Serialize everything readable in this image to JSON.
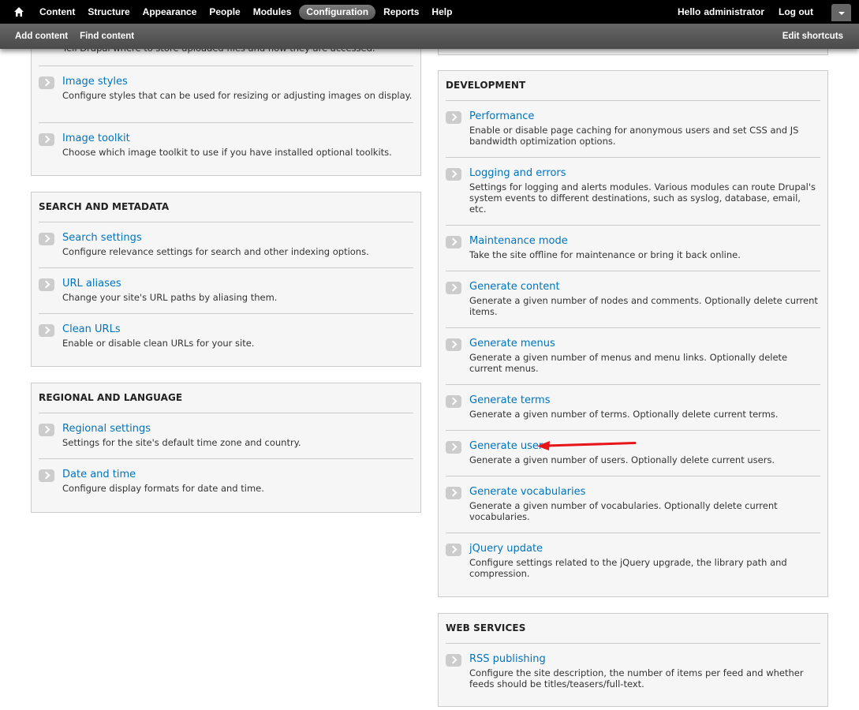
{
  "toolbar": {
    "menu": [
      "Content",
      "Structure",
      "Appearance",
      "People",
      "Modules",
      "Configuration",
      "Reports",
      "Help"
    ],
    "active_index": 5,
    "hello": "Hello",
    "username": "administrator",
    "logout": "Log out",
    "shortcuts": [
      "Add content",
      "Find content"
    ],
    "edit_shortcuts": "Edit shortcuts",
    "icons": {
      "home": "home-icon",
      "toggle": "chevron-down-icon"
    }
  },
  "left": {
    "media_tail": "Tell Drupal where to store uploaded files and how they are accessed.",
    "media_items": [
      {
        "title": "Image styles",
        "desc": "Configure styles that can be used for resizing or adjusting images on display."
      },
      {
        "title": "Image toolkit",
        "desc": "Choose which image toolkit to use if you have installed optional toolkits."
      }
    ],
    "search": {
      "heading": "SEARCH AND METADATA",
      "items": [
        {
          "title": "Search settings",
          "desc": "Configure relevance settings for search and other indexing options."
        },
        {
          "title": "URL aliases",
          "desc": "Change your site's URL paths by aliasing them."
        },
        {
          "title": "Clean URLs",
          "desc": "Enable or disable clean URLs for your site."
        }
      ]
    },
    "regional": {
      "heading": "REGIONAL AND LANGUAGE",
      "items": [
        {
          "title": "Regional settings",
          "desc": "Settings for the site's default time zone and country."
        },
        {
          "title": "Date and time",
          "desc": "Configure display formats for date and time."
        }
      ]
    }
  },
  "right": {
    "development": {
      "heading": "DEVELOPMENT",
      "items": [
        {
          "title": "Performance",
          "desc": "Enable or disable page caching for anonymous users and set CSS and JS bandwidth optimization options."
        },
        {
          "title": "Logging and errors",
          "desc": "Settings for logging and alerts modules. Various modules can route Drupal's system events to different destinations, such as syslog, database, email, etc."
        },
        {
          "title": "Maintenance mode",
          "desc": "Take the site offline for maintenance or bring it back online."
        },
        {
          "title": "Generate content",
          "desc": "Generate a given number of nodes and comments. Optionally delete current items."
        },
        {
          "title": "Generate menus",
          "desc": "Generate a given number of menus and menu links. Optionally delete current menus."
        },
        {
          "title": "Generate terms",
          "desc": "Generate a given number of terms. Optionally delete current terms."
        },
        {
          "title": "Generate users",
          "desc": "Generate a given number of users. Optionally delete current users."
        },
        {
          "title": "Generate vocabularies",
          "desc": "Generate a given number of vocabularies. Optionally delete current vocabularies."
        },
        {
          "title": "jQuery update",
          "desc": "Configure settings related to the jQuery upgrade, the library path and compression."
        }
      ]
    },
    "web": {
      "heading": "WEB SERVICES",
      "items": [
        {
          "title": "RSS publishing",
          "desc": "Configure the site description, the number of items per feed and whether feeds should be titles/teasers/full-text."
        }
      ]
    }
  },
  "annotation": {
    "arrow_color": "#e8161b"
  },
  "colors": {
    "link": "#0074bd",
    "toolbar": "#000000"
  }
}
